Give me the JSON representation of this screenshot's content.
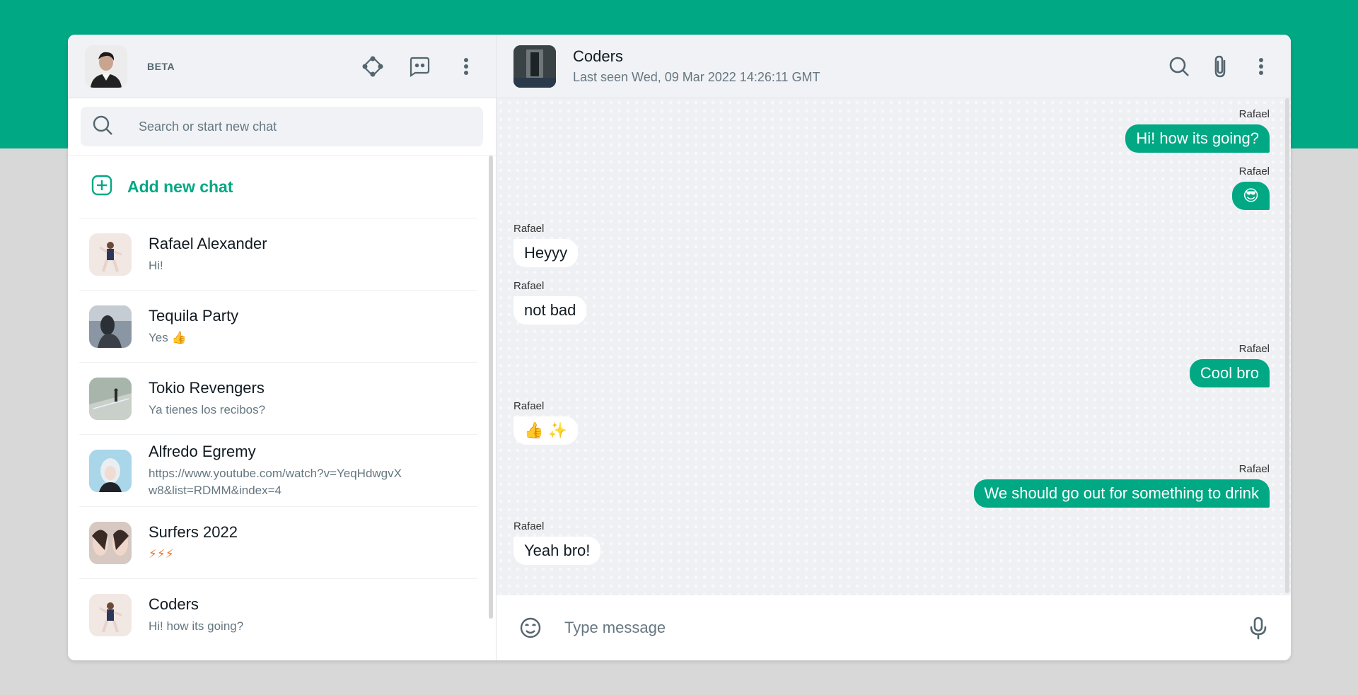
{
  "colors": {
    "accent": "#00a884",
    "header_bg": "#f0f2f5",
    "chat_bg": "#eff0f3"
  },
  "sidebar": {
    "badge": "BETA",
    "icons": [
      "communities-icon",
      "new-chat-icon",
      "menu-dots-icon"
    ],
    "search": {
      "placeholder": "Search or start new chat"
    },
    "add_chat_label": "Add new chat",
    "chats": [
      {
        "name": "Rafael Alexander",
        "last": "Hi!"
      },
      {
        "name": "Tequila Party",
        "last": "Yes 👍"
      },
      {
        "name": "Tokio Revengers",
        "last": "Ya tienes los recibos?"
      },
      {
        "name": "Alfredo Egremy",
        "last": "https://www.youtube.com/watch?v=YeqHdwgvXw8&list=RDMM&index=4"
      },
      {
        "name": "Surfers 2022",
        "last": "⚡⚡⚡"
      },
      {
        "name": "Coders",
        "last": "Hi! how its going?"
      }
    ]
  },
  "conversation": {
    "title": "Coders",
    "status": "Last seen Wed, 09 Mar 2022 14:26:11 GMT",
    "icons": [
      "search-icon",
      "attach-icon",
      "menu-dots-icon"
    ],
    "messages": [
      {
        "dir": "out",
        "sender": "Rafael",
        "text": "Hi! how its going?"
      },
      {
        "dir": "out",
        "sender": "Rafael",
        "text": "😎"
      },
      {
        "dir": "in",
        "sender": "Rafael",
        "text": "Heyyy"
      },
      {
        "dir": "in",
        "sender": "Rafael",
        "text": "not bad"
      },
      {
        "dir": "out",
        "sender": "Rafael",
        "text": "Cool bro"
      },
      {
        "dir": "in",
        "sender": "Rafael",
        "text": "👍 ✨"
      },
      {
        "dir": "out",
        "sender": "Rafael",
        "text": "We should go out for something to drink"
      },
      {
        "dir": "in",
        "sender": "Rafael",
        "text": "Yeah bro!"
      }
    ],
    "composer": {
      "placeholder": "Type message"
    }
  }
}
